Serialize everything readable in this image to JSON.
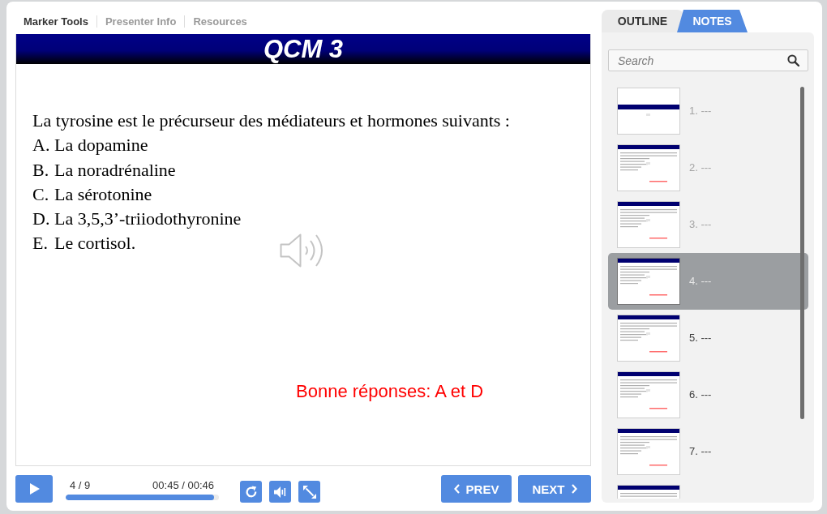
{
  "top_tabs": [
    {
      "label": "Marker Tools",
      "selected": true
    },
    {
      "label": "Presenter Info",
      "selected": false
    },
    {
      "label": "Resources",
      "selected": false
    }
  ],
  "slide": {
    "title": "QCM 3",
    "question": "La tyrosine est le précurseur des médiateurs et hormones suivants :",
    "options": [
      {
        "marker": "A.",
        "text": "La dopamine"
      },
      {
        "marker": "B.",
        "text": "La noradrénaline"
      },
      {
        "marker": "C.",
        "text": "La sérotonine"
      },
      {
        "marker": "D.",
        "text": "La 3,5,3’-triiodothyronine"
      },
      {
        "marker": "E.",
        "text": "Le cortisol."
      }
    ],
    "answer": "Bonne réponses: A et D"
  },
  "player": {
    "slide_counter": "4 / 9",
    "time": "00:45 / 00:46",
    "progress": {
      "level": 0.97
    },
    "prev": "PREV",
    "next": "NEXT"
  },
  "side_tabs": [
    {
      "label": "OUTLINE",
      "selected": false
    },
    {
      "label": "NOTES",
      "selected": true
    }
  ],
  "search": {
    "placeholder": "Search"
  },
  "slides": [
    {
      "label": "1. ---",
      "kind": "title",
      "visited": true,
      "selected": false
    },
    {
      "label": "2. ---",
      "kind": "question",
      "visited": true,
      "selected": false
    },
    {
      "label": "3. ---",
      "kind": "question",
      "visited": true,
      "selected": false
    },
    {
      "label": "4. ---",
      "kind": "question",
      "visited": true,
      "selected": true
    },
    {
      "label": "5. ---",
      "kind": "question",
      "visited": false,
      "selected": false
    },
    {
      "label": "6. ---",
      "kind": "question",
      "visited": false,
      "selected": false
    },
    {
      "label": "7. ---",
      "kind": "question",
      "visited": false,
      "selected": false
    },
    {
      "kind": "question",
      "selected": false
    }
  ]
}
